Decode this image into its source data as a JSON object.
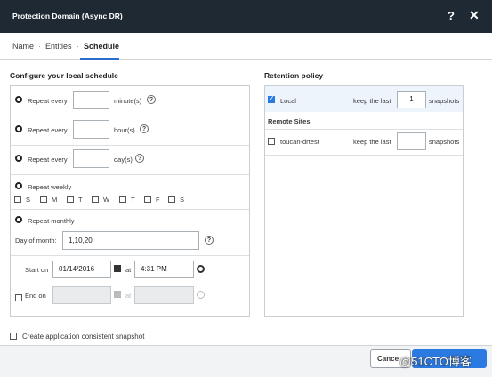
{
  "dialog": {
    "title": "Protection Domain (Async DR)",
    "help_glyph": "?",
    "close_glyph": "✕"
  },
  "tabs": {
    "name": "Name",
    "entities": "Entities",
    "schedule": "Schedule",
    "separator": "·"
  },
  "schedule": {
    "heading": "Configure your local schedule",
    "repeat_every_label": "Repeat every",
    "minutes_unit": "minute(s)",
    "hours_unit": "hour(s)",
    "days_unit": "day(s)",
    "repeat_weekly": "Repeat weekly",
    "weekdays": [
      "S",
      "M",
      "T",
      "W",
      "T",
      "F",
      "S"
    ],
    "repeat_monthly": "Repeat monthly",
    "day_of_month_label": "Day of month:",
    "day_of_month_value": "1,10,20",
    "start_on_label": "Start on",
    "start_date": "01/14/2016",
    "at_label": "at",
    "start_time": "4:31 PM",
    "end_on_label": "End on",
    "help_glyph": "?"
  },
  "retention": {
    "heading": "Retention policy",
    "local_label": "Local",
    "keep_last_label": "keep the last",
    "local_count": "1",
    "snapshots_label": "snapshots",
    "remote_sites_label": "Remote Sites",
    "remote_site_name": "toucan-drtest",
    "remote_count": ""
  },
  "app_consistent_label": "Create application consistent snapshot",
  "footer": {
    "cancel_label": "Cance",
    "watermark": "@51CTO博客"
  },
  "colors": {
    "title_bar": "#1f2933",
    "accent": "#2a7ae2"
  }
}
